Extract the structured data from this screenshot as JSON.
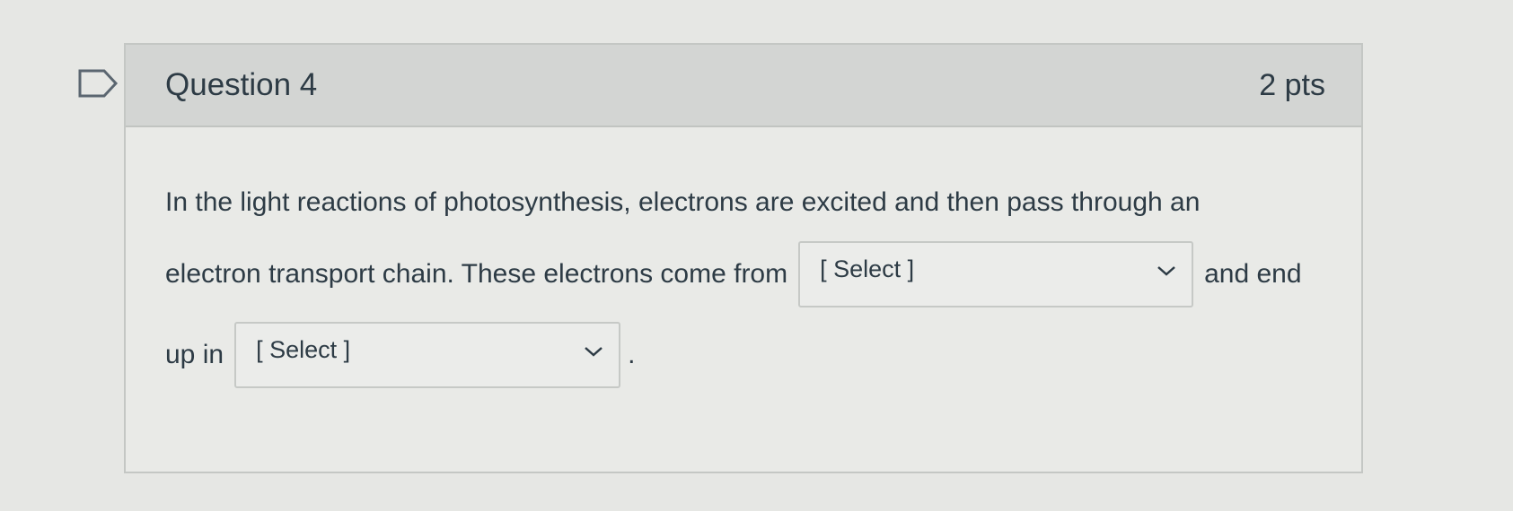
{
  "question": {
    "title": "Question 4",
    "points": "2 pts",
    "text_line1": "In the light reactions of photosynthesis, electrons are excited and then pass through an",
    "text_line2_before": "electron transport chain. These electrons come from",
    "text_line2_after": "and end",
    "text_line3_before": "up in",
    "text_line3_after": "."
  },
  "dropdowns": [
    {
      "selected": "[ Select ]"
    },
    {
      "selected": "[ Select ]"
    }
  ]
}
